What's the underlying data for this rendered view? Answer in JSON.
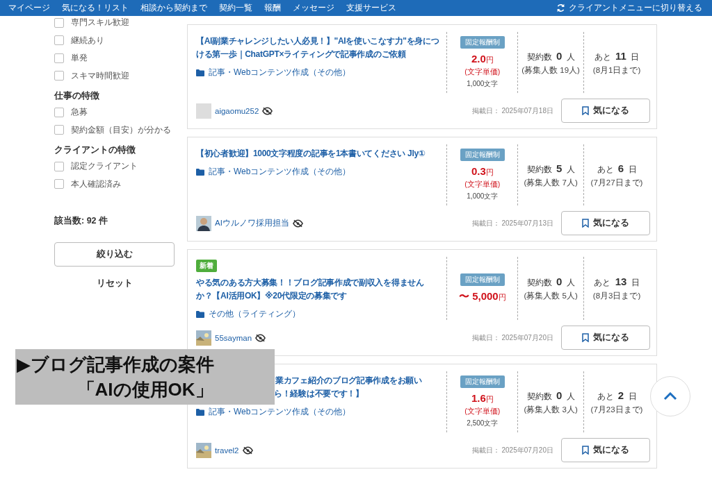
{
  "nav": {
    "items": [
      "マイページ",
      "気になる！リスト",
      "相談から契約まで",
      "契約一覧",
      "報酬",
      "メッセージ",
      "支援サービス"
    ],
    "switch": "クライアントメニューに切り替える"
  },
  "sidebar": {
    "groups": [
      {
        "options": [
          {
            "label": "専門スキル歓迎",
            "checked": false
          },
          {
            "label": "継続あり",
            "checked": false
          },
          {
            "label": "単発",
            "checked": false
          },
          {
            "label": "スキマ時間歓迎",
            "checked": false
          }
        ]
      },
      {
        "heading": "仕事の特徴",
        "options": [
          {
            "label": "急募",
            "checked": false
          },
          {
            "label": "契約金額（目安）が分かる",
            "checked": false
          }
        ]
      },
      {
        "heading": "クライアントの特徴",
        "options": [
          {
            "label": "認定クライアント",
            "checked": false
          },
          {
            "label": "本人確認済み",
            "checked": false
          }
        ]
      }
    ],
    "count": "該当数: 92 件",
    "apply": "絞り込む",
    "reset": "リセット"
  },
  "jobs": [
    {
      "title": "【AI副業チャレンジしたい人必見！】\"AIを使いこなす力\"を身につける第一歩｜ChatGPT×ライティングで記事作成のご依頼",
      "category": "記事・Webコンテンツ作成（その他）",
      "pay_type": "固定報酬制",
      "price": "2.0",
      "currency": "円",
      "unit": "(文字単価)",
      "length": "1,000文字",
      "contracts_label": "契約数",
      "contracts": "0",
      "contracts_unit": "人",
      "recruit": "(募集人数 19人)",
      "days_label": "あと",
      "days": "11",
      "days_unit": "日",
      "deadline": "(8月1日まで)",
      "avatar": {
        "kind": "blank"
      },
      "user": "aigaomu252",
      "posted_label": "掲載日：",
      "posted": "2025年07月18日",
      "fav": "気になる"
    },
    {
      "title": "【初心者歓迎】1000文字程度の記事を1本書いてください Jly①",
      "category": "記事・Webコンテンツ作成（その他）",
      "pay_type": "固定報酬制",
      "price": "0.3",
      "currency": "円",
      "unit": "(文字単価)",
      "length": "1,000文字",
      "contracts_label": "契約数",
      "contracts": "5",
      "contracts_unit": "人",
      "recruit": "(募集人数 7人)",
      "days_label": "あと",
      "days": "6",
      "days_unit": "日",
      "deadline": "(7月27日まで)",
      "avatar": {
        "kind": "figure"
      },
      "user": "AIウルノワ採用担当",
      "posted_label": "掲載日：",
      "posted": "2025年07月13日",
      "fav": "気になる"
    },
    {
      "new_badge": "新着",
      "title": "やる気のある方大募集！！ブログ記事作成で副収入を得ませんか？【AI活用OK】※20代限定の募集です",
      "category": "その他（ライティング）",
      "pay_type": "固定報酬制",
      "price": "〜 5,000",
      "currency": "円",
      "contracts_label": "契約数",
      "contracts": "0",
      "contracts_unit": "人",
      "recruit": "(募集人数 5人)",
      "days_label": "あと",
      "days": "13",
      "days_unit": "日",
      "deadline": "(8月3日まで)",
      "avatar": {
        "kind": "picture"
      },
      "user": "55sayman",
      "posted_label": "掲載日：",
      "posted": "2025年07月20日",
      "fav": "気になる"
    },
    {
      "title_parts": [
        "業カフェ紹介のブログ記事作成をお願い",
        "ら！経験は不要です！】"
      ],
      "category": "記事・Webコンテンツ作成（その他）",
      "pay_type": "固定報酬制",
      "price": "1.6",
      "currency": "円",
      "unit": "(文字単価)",
      "length": "2,500文字",
      "contracts_label": "契約数",
      "contracts": "0",
      "contracts_unit": "人",
      "recruit": "(募集人数 3人)",
      "days_label": "あと",
      "days": "2",
      "days_unit": "日",
      "deadline": "(7月23日まで)",
      "avatar": {
        "kind": "picture"
      },
      "user": "travel2",
      "posted_label": "掲載日：",
      "posted": "2025年07月20日",
      "fav": "気になる"
    }
  ],
  "caption": {
    "lines": [
      "▶ブログ記事作成の案件",
      "「AIの使用OK」"
    ]
  }
}
